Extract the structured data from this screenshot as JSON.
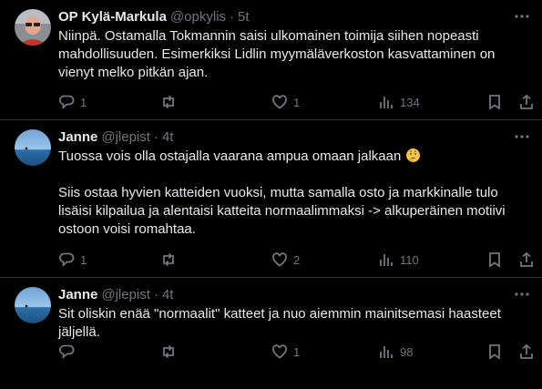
{
  "tweets": [
    {
      "name": "OP Kylä-Markula",
      "handle": "@opkylis",
      "dot": "·",
      "time": "5t",
      "text": "Niinpä. Ostamalla Tokmannin saisi ulkomainen toimija siihen nopeasti mahdollisuuden. Esimerkiksi Lidlin myymäläverkoston kasvattaminen on vienyt melko pitkän ajan.",
      "replies": "1",
      "retweets": "",
      "likes": "1",
      "views": "134"
    },
    {
      "name": "Janne",
      "handle": "@jlepist",
      "dot": "·",
      "time": "4t",
      "text_line1": "Tuossa vois olla ostajalla vaarana ampua omaan jalkaan",
      "text_rest": "Siis ostaa hyvien katteiden vuoksi, mutta samalla osto ja markkinalle tulo lisäisi kilpailua ja alentaisi katteita normaalimmaksi -> alkuperäinen motiivi ostoon voisi romahtaa.",
      "emoji": "thinking-face",
      "replies": "1",
      "retweets": "",
      "likes": "2",
      "views": "110"
    },
    {
      "name": "Janne",
      "handle": "@jlepist",
      "dot": "·",
      "time": "4t",
      "text": "Sit oliskin enää \"normaalit\" katteet ja nuo aiemmin mainitsemasi haasteet jäljellä.",
      "replies": "",
      "retweets": "",
      "likes": "1",
      "views": "98"
    }
  ],
  "icons": {
    "more": "more-dots-icon",
    "reply": "reply-icon",
    "retweet": "retweet-icon",
    "like": "heart-icon",
    "views": "views-icon",
    "bookmark": "bookmark-icon",
    "share": "share-icon"
  },
  "colors": {
    "background": "#000000",
    "text": "#e7e9ea",
    "muted": "#71767b",
    "divider": "#2f3336"
  }
}
